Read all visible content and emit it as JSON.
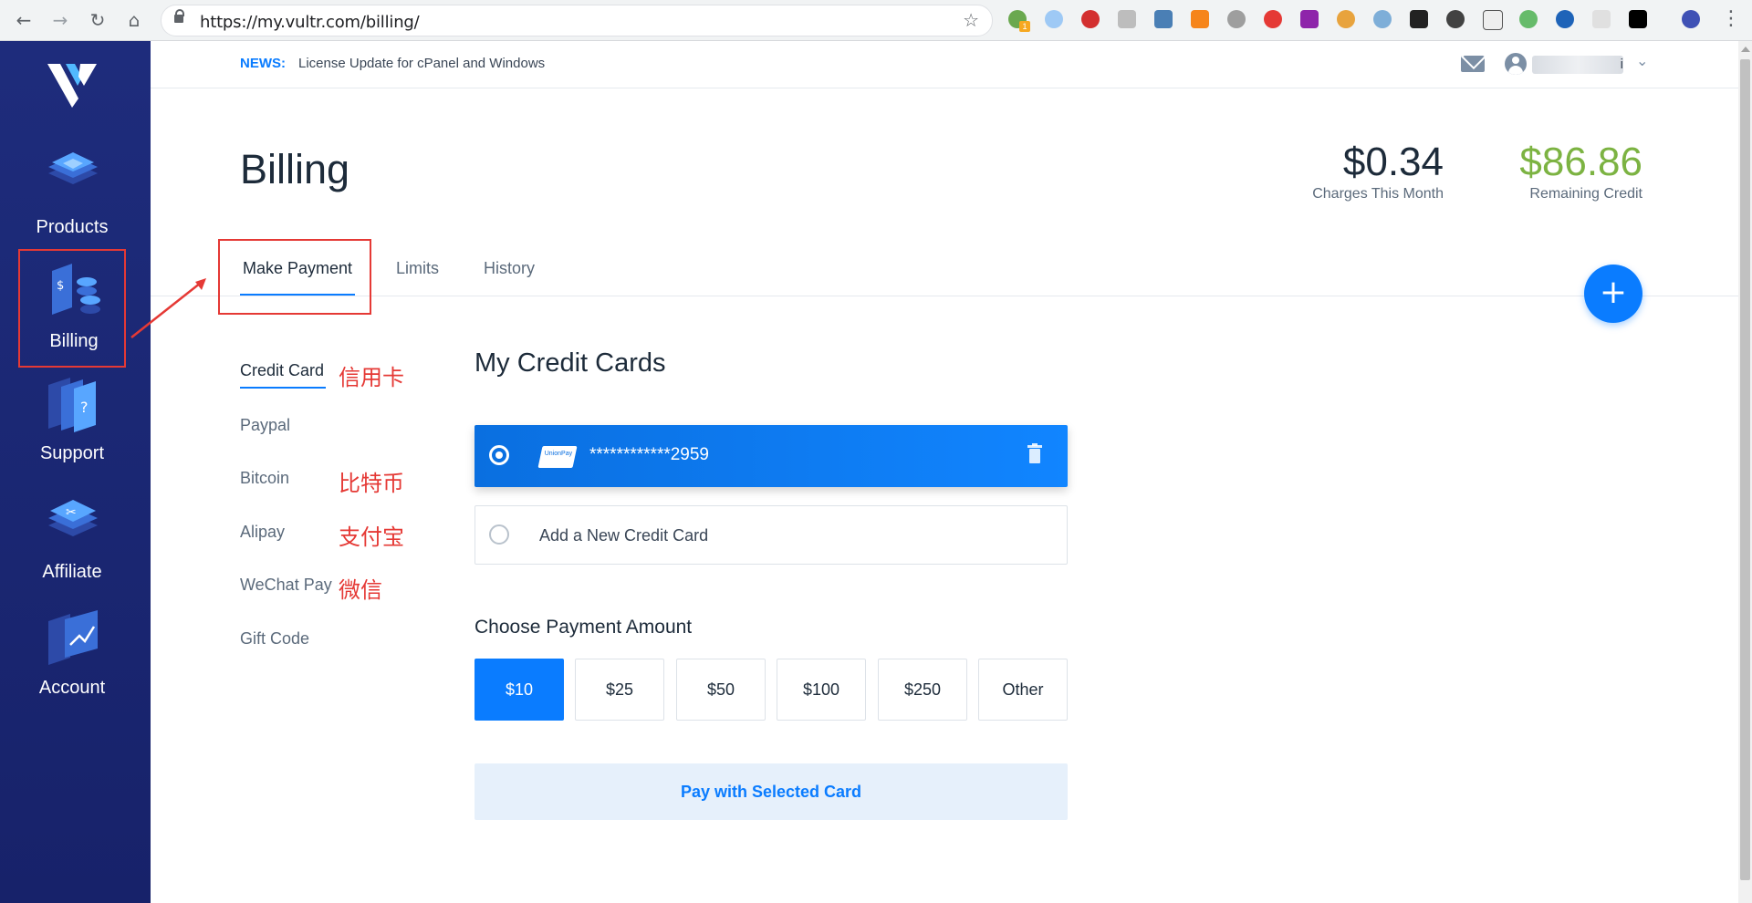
{
  "browser": {
    "url": "https://my.vultr.com/billing/",
    "ext_badge": "1"
  },
  "sidebar": {
    "items": [
      {
        "label": "Products",
        "icon": "layers-icon"
      },
      {
        "label": "Billing",
        "icon": "billing-icon"
      },
      {
        "label": "Support",
        "icon": "support-icon"
      },
      {
        "label": "Affiliate",
        "icon": "affiliate-icon"
      },
      {
        "label": "Account",
        "icon": "account-icon"
      }
    ],
    "active": "Billing"
  },
  "topbar": {
    "news_tag": "NEWS:",
    "news_text": "License Update for cPanel and Windows",
    "user_suffix": "i"
  },
  "header": {
    "title": "Billing",
    "charges_value": "$0.34",
    "charges_label": "Charges This Month",
    "credit_value": "$86.86",
    "credit_label": "Remaining Credit"
  },
  "tabs": [
    {
      "label": "Make Payment",
      "active": true
    },
    {
      "label": "Limits",
      "active": false
    },
    {
      "label": "History",
      "active": false
    }
  ],
  "fab": "+",
  "payment_methods": [
    {
      "label": "Credit Card",
      "note": "信用卡",
      "active": true
    },
    {
      "label": "Paypal",
      "note": ""
    },
    {
      "label": "Bitcoin",
      "note": "比特币"
    },
    {
      "label": "Alipay",
      "note": "支付宝"
    },
    {
      "label": "WeChat Pay",
      "note": "微信"
    },
    {
      "label": "Gift Code",
      "note": ""
    }
  ],
  "cards": {
    "title": "My Credit Cards",
    "selected_number": "************2959",
    "card_brand": "UnionPay",
    "add_new_label": "Add a New Credit Card"
  },
  "amount": {
    "title": "Choose Payment Amount",
    "options": [
      "$10",
      "$25",
      "$50",
      "$100",
      "$250",
      "Other"
    ],
    "selected": "$10"
  },
  "pay_button": "Pay with Selected Card",
  "colors": {
    "sidebar": "#1e2c7c",
    "accent": "#0a7cff",
    "credit": "#7cb342",
    "annotation": "#e53935"
  }
}
